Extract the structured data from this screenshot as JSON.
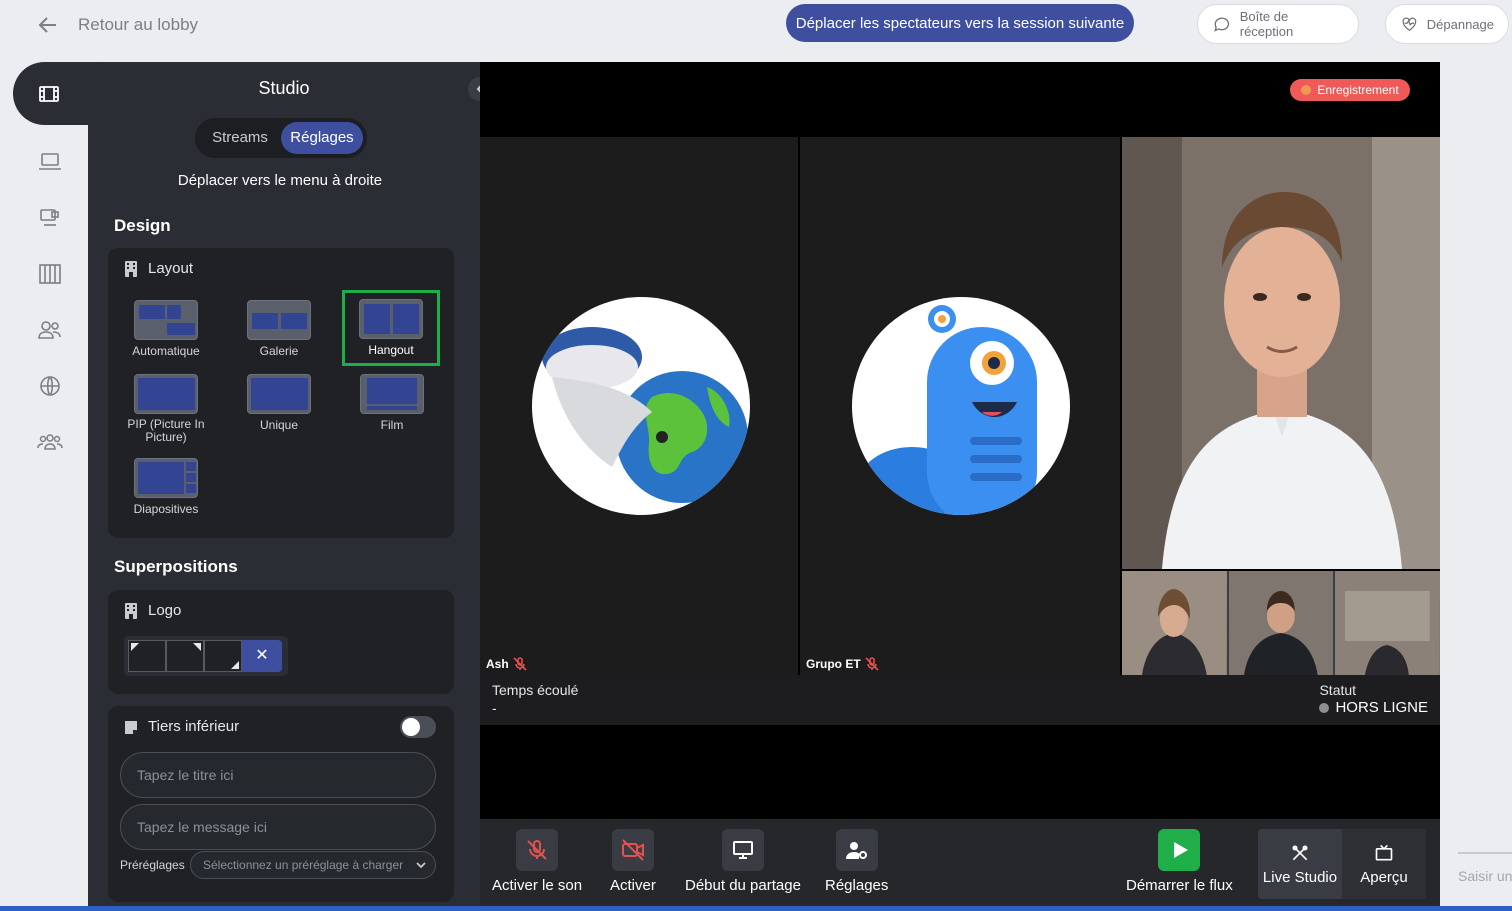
{
  "topbar": {
    "back_label": "Retour au lobby",
    "move_label": "Déplacer les spectateurs vers la session suivante",
    "inbox_label": "Boîte de réception",
    "support_label": "Dépannage"
  },
  "rail": {
    "items": [
      "film-icon",
      "laptop-icon",
      "screen-icon",
      "columns-icon",
      "users-icon",
      "globe-icon",
      "group-icon"
    ]
  },
  "studio": {
    "title": "Studio",
    "tabs": [
      "Streams",
      "Réglages"
    ],
    "active_tab": "Réglages",
    "move_right_label": "Déplacer vers le menu à droite",
    "design_heading": "Design",
    "layout_label": "Layout",
    "layouts": [
      {
        "label": "Automatique"
      },
      {
        "label": "Galerie"
      },
      {
        "label": "Hangout",
        "selected": true
      },
      {
        "label": "PIP (Picture In Picture)"
      },
      {
        "label": "Unique"
      },
      {
        "label": "Film"
      },
      {
        "label": "Diapositives"
      }
    ],
    "overlays_heading": "Superpositions",
    "logo_label": "Logo",
    "logo_clear": "✕",
    "lower_third_label": "Tiers inférieur",
    "lower_third_on": false,
    "title_placeholder": "Tapez le titre ici",
    "message_placeholder": "Tapez le message ici",
    "presets_label": "Préréglages",
    "presets_placeholder": "Sélectionnez un préréglage à charger"
  },
  "stage": {
    "recording_label": "Enregistrement",
    "participants": [
      {
        "name": "Ash",
        "muted": true
      },
      {
        "name": "Grupo ET",
        "muted": true
      }
    ],
    "elapsed_label": "Temps écoulé",
    "elapsed_value": "-",
    "status_label": "Statut",
    "status_value": "HORS LIGNE"
  },
  "controls": {
    "unmute_label": "Activer le son",
    "camera_label": "Activer",
    "share_label": "Début du partage",
    "settings_label": "Réglages",
    "start_label": "Démarrer le flux",
    "live_studio_label": "Live Studio",
    "preview_label": "Aperçu"
  },
  "chat": {
    "input_placeholder": "Saisir un"
  },
  "colors": {
    "accent": "#3f4fa0",
    "selected_outline": "#1fae48",
    "recording": "#ee5a57",
    "panel_bg": "#2a2d33"
  }
}
